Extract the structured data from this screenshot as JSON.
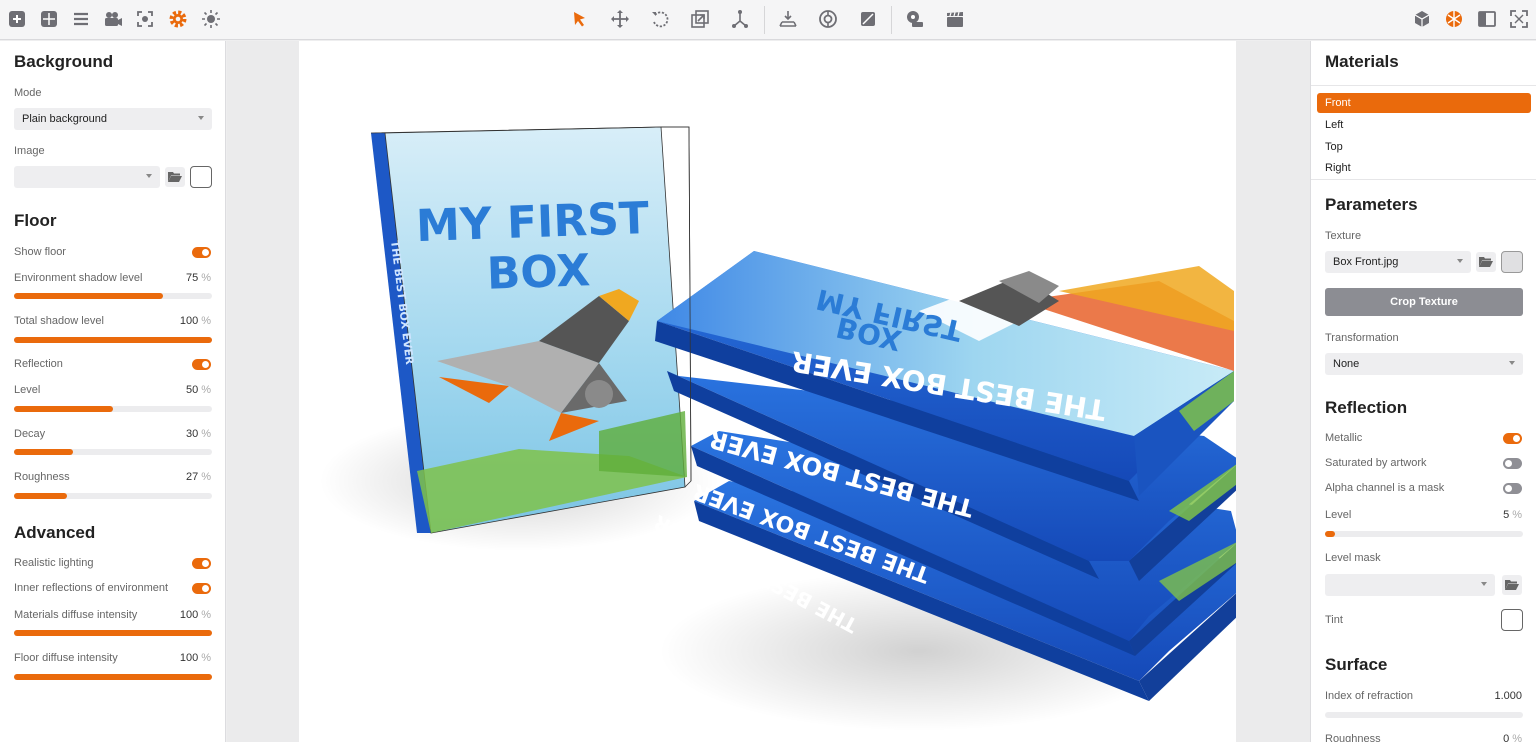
{
  "toolbar": {
    "left_icons": [
      "add-icon",
      "grid-icon",
      "list-icon",
      "camera-icon",
      "focus-icon",
      "gear-icon",
      "light-icon"
    ],
    "center_icons": [
      "select-arrow-icon",
      "move-icon",
      "rotate-icon",
      "scale-icon",
      "pivot-icon",
      "floor-align-icon",
      "turntable-icon",
      "material-icon",
      "render-icon",
      "clapper-icon"
    ],
    "right_icons": [
      "box-icon",
      "materials-ball-icon",
      "layout-icon",
      "fullscreen-icon"
    ]
  },
  "left_panel": {
    "background": {
      "title": "Background",
      "mode_label": "Mode",
      "mode_value": "Plain background",
      "image_label": "Image",
      "image_value": ""
    },
    "floor": {
      "title": "Floor",
      "show_floor_label": "Show floor",
      "show_floor": true,
      "env_shadow": {
        "label": "Environment shadow level",
        "value": "75",
        "unit": "%",
        "level": 0.75
      },
      "total_shadow": {
        "label": "Total shadow level",
        "value": "100",
        "unit": "%",
        "level": 1.0
      },
      "reflection_label": "Reflection",
      "reflection": true,
      "level": {
        "label": "Level",
        "value": "50",
        "unit": "%",
        "level": 0.5
      },
      "decay": {
        "label": "Decay",
        "value": "30",
        "unit": "%",
        "level": 0.3
      },
      "roughness": {
        "label": "Roughness",
        "value": "27",
        "unit": "%",
        "level": 0.27
      }
    },
    "advanced": {
      "title": "Advanced",
      "realistic_lighting_label": "Realistic lighting",
      "realistic_lighting": true,
      "inner_reflections_label": "Inner reflections of environment",
      "inner_reflections": true,
      "materials_diffuse": {
        "label": "Materials diffuse intensity",
        "value": "100",
        "unit": "%",
        "level": 1.0
      },
      "floor_diffuse": {
        "label": "Floor diffuse intensity",
        "value": "100",
        "unit": "%",
        "level": 1.0
      }
    }
  },
  "scene": {
    "front_box_title_line1": "MY FIRST",
    "front_box_title_line2": "BOX",
    "stack_box_top_title_line1": "MY FIRST",
    "stack_box_top_title_line2": "BOX",
    "spine_text": "THE BEST BOX EVER",
    "stack_spines": [
      "THE BEST BOX EVER",
      "THE BEST BOX EVER",
      "THE BEST BOX EVER",
      "THE BEST BOX EVER"
    ]
  },
  "right_panel": {
    "materials": {
      "title": "Materials",
      "items": [
        "Front",
        "Left",
        "Top",
        "Right"
      ],
      "selected": "Front"
    },
    "parameters": {
      "title": "Parameters",
      "texture_label": "Texture",
      "texture_value": "Box Front.jpg",
      "crop_button": "Crop Texture",
      "transformation_label": "Transformation",
      "transformation_value": "None"
    },
    "reflection": {
      "title": "Reflection",
      "metallic_label": "Metallic",
      "metallic": true,
      "saturated_label": "Saturated by artwork",
      "saturated": false,
      "alpha_label": "Alpha channel is a mask",
      "alpha": false,
      "level": {
        "label": "Level",
        "value": "5",
        "unit": "%",
        "level": 0.05
      },
      "level_mask_label": "Level mask",
      "level_mask_value": "",
      "tint_label": "Tint"
    },
    "surface": {
      "title": "Surface",
      "ior_label": "Index of refraction",
      "ior_value": "1.000",
      "ior_level": 0,
      "roughness_label": "Roughness",
      "roughness_value": "0",
      "roughness_unit": "%"
    }
  },
  "colors": {
    "accent": "#ea6a0c",
    "box_blue": "#1e5fd0",
    "box_sky": "#8fd0ea"
  }
}
